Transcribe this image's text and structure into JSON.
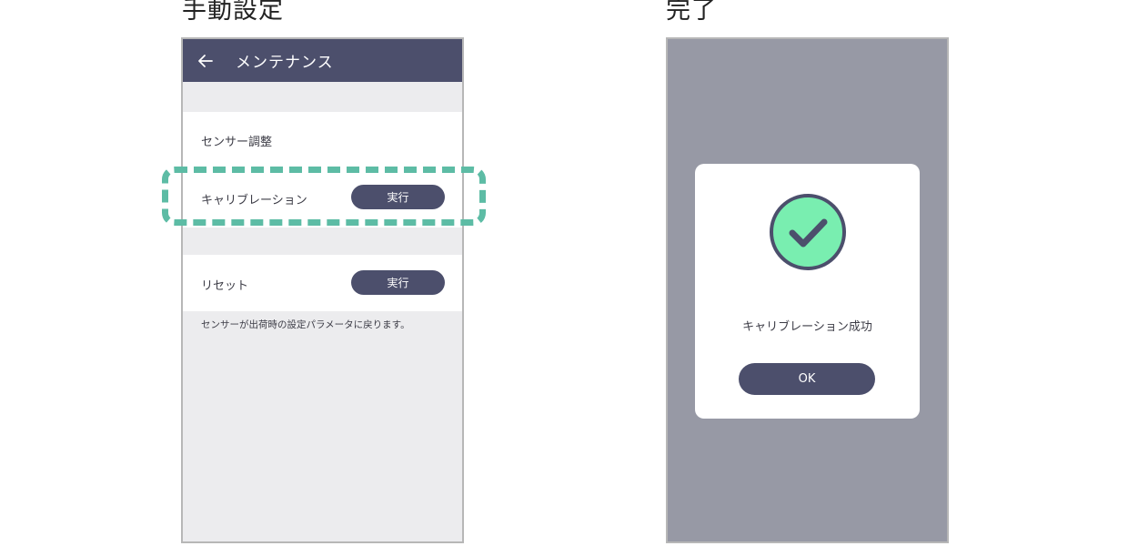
{
  "captions": {
    "left": "手動設定",
    "right": "完了"
  },
  "maintenance_screen": {
    "title": "メンテナンス",
    "back_icon": "arrow-left-icon",
    "sensor_section": {
      "title": "センサー調整",
      "calibration": {
        "label": "キャリブレーション",
        "button": "実行"
      }
    },
    "reset_section": {
      "label": "リセット",
      "button": "実行",
      "note": "センサーが出荷時の設定パラメータに戻ります。"
    },
    "highlight_color": "#5dbca5"
  },
  "complete_screen": {
    "dialog": {
      "icon": "check-circle-icon",
      "message": "キャリブレーション成功",
      "ok_button": "OK"
    },
    "overlay_color": "#9799a5"
  },
  "colors": {
    "primary": "#4c4f6c",
    "success": "#79eeb0",
    "background": "#ececee"
  }
}
